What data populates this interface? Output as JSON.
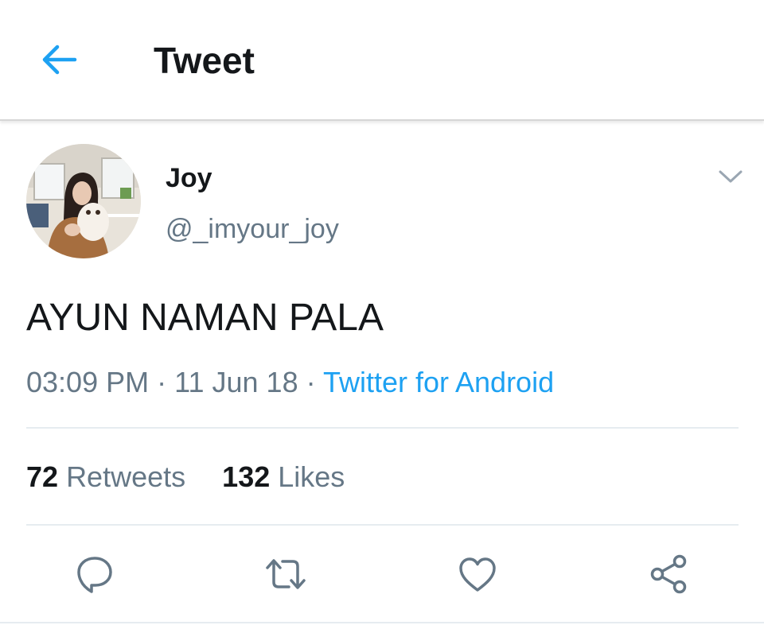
{
  "colors": {
    "accent": "#1da1f2",
    "text": "#14171a",
    "muted": "#657786",
    "divider": "#e6ecf0"
  },
  "header": {
    "back_icon": "arrow-left-icon",
    "title": "Tweet"
  },
  "tweet": {
    "author": {
      "display_name": "Joy",
      "handle": "@_imyour_joy"
    },
    "menu_icon": "chevron-down-icon",
    "text": "AYUN NAMAN PALA",
    "time": "03:09 PM",
    "date": "11 Jun 18",
    "separator": "·",
    "source": "Twitter for Android",
    "stats": {
      "retweets_count": "72",
      "retweets_label": "Retweets",
      "likes_count": "132",
      "likes_label": "Likes"
    },
    "actions": [
      {
        "icon": "reply-icon"
      },
      {
        "icon": "retweet-icon"
      },
      {
        "icon": "heart-icon"
      },
      {
        "icon": "share-icon"
      }
    ]
  }
}
